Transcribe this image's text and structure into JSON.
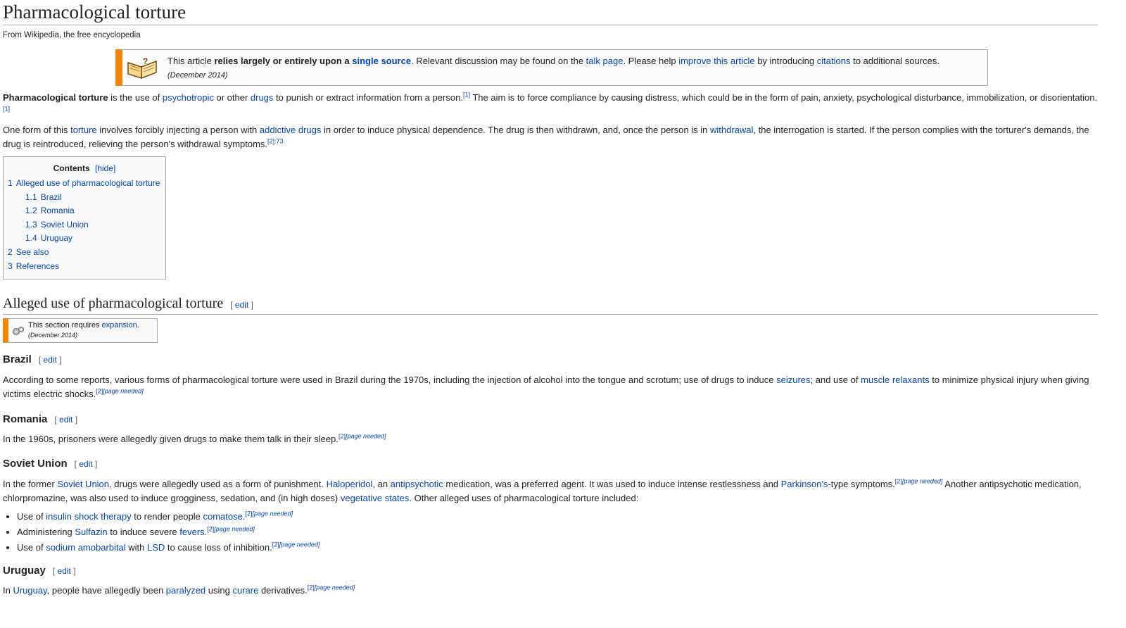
{
  "title": "Pharmacological torture",
  "site_sub": "From Wikipedia, the free encyclopedia",
  "notice": {
    "t1": "This article ",
    "b1": "relies largely or entirely upon a ",
    "l1": "single source",
    "t2": ". Relevant discussion may be found on the ",
    "l2": "talk page",
    "t3": ". Please help ",
    "l3": "improve this article",
    "t4": " by introducing ",
    "l4": "citations",
    "t5": " to additional sources.",
    "date": "(December 2014)",
    "icon": "book-question-icon"
  },
  "intro1": {
    "bold": "Pharmacological torture",
    "t1": " is the use of ",
    "l1": "psychotropic",
    "t2": " or other ",
    "l2": "drugs",
    "t3": " to punish or extract information from a person.",
    "ref1": "[1]",
    "t4": " The aim is to force compliance by causing distress, which could be in the form of pain, anxiety, psychological disturbance, immobilization, or disorientation.",
    "ref2": "[1]"
  },
  "intro2": {
    "t1": "One form of this ",
    "l1": "torture",
    "t2": " involves forcibly injecting a person with ",
    "l2": "addictive drugs",
    "t3": " in order to induce physical dependence. The drug is then withdrawn, and, once the person is in ",
    "l3": "withdrawal",
    "t4": ", the interrogation is started. If the person complies with the torturer's demands, the drug is reintroduced, relieving the person's withdrawal symptoms.",
    "ref": "[2]:73"
  },
  "toc": {
    "title": "Contents",
    "hide": "[hide]",
    "items": [
      {
        "num": "1",
        "label": "Alleged use of pharmacological torture"
      },
      {
        "num": "1.1",
        "label": "Brazil"
      },
      {
        "num": "1.2",
        "label": "Romania"
      },
      {
        "num": "1.3",
        "label": "Soviet Union"
      },
      {
        "num": "1.4",
        "label": "Uruguay"
      },
      {
        "num": "2",
        "label": "See also"
      },
      {
        "num": "3",
        "label": "References"
      }
    ]
  },
  "edit_label": "[ edit ]",
  "edit_open": "[ ",
  "edit_word": "edit",
  "edit_close": " ]",
  "section1": {
    "heading": "Alleged use of pharmacological torture",
    "expansion": {
      "t1": "This section requires ",
      "l1": "expansion",
      "t2": ".",
      "date": "(December 2014)",
      "icon": "gears-icon"
    }
  },
  "brazil": {
    "heading": "Brazil",
    "t1": "According to some reports, various forms of pharmacological torture were used in Brazil during the 1970s, including the injection of alcohol into the tongue and scrotum; use of drugs to induce ",
    "l1": "seizures",
    "t2": "; and use of ",
    "l2": "muscle relaxants",
    "t3": " to minimize physical injury when giving victims electric shocks.",
    "ref": "[2]",
    "pn": "[page needed]"
  },
  "romania": {
    "heading": "Romania",
    "t1": "In the 1960s, prisoners were allegedly given drugs to make them talk in their sleep.",
    "ref": "[2]",
    "pn": "[page needed]"
  },
  "soviet": {
    "heading": "Soviet Union",
    "t1": "In the former ",
    "l1": "Soviet Union",
    "t2": ", drugs were allegedly used as a form of punishment. ",
    "l2": "Haloperidol",
    "t3": ", an ",
    "l3": "antipsychotic",
    "t4": " medication, was a preferred agent. It was used to induce intense restlessness and ",
    "l4": "Parkinson's",
    "t5": "-type symptoms.",
    "ref1": "[2]",
    "pn1": "[page needed]",
    "t6": " Another antipsychotic medication, chlorpromazine, was also used to induce grogginess, sedation, and (in high doses) ",
    "l5": "vegetative states",
    "t7": ". Other alleged uses of pharmacological torture included:",
    "bullets": [
      {
        "t1": "Use of ",
        "l1": "insulin shock therapy",
        "t2": " to render people ",
        "l2": "comatose",
        "t3": ".",
        "ref": "[2]",
        "pn": "[page needed]"
      },
      {
        "t1": "Administering ",
        "l1": "Sulfazin",
        "t2": " to induce severe ",
        "l2": "fevers",
        "t3": ".",
        "ref": "[2]",
        "pn": "[page needed]"
      },
      {
        "t1": "Use of ",
        "l1": "sodium amobarbital",
        "t2": " with ",
        "l2": "LSD",
        "t3": " to cause loss of inhibition.",
        "ref": "[2]",
        "pn": "[page needed]"
      }
    ]
  },
  "uruguay": {
    "heading": "Uruguay",
    "t1": "In ",
    "l1": "Uruguay",
    "t2": ", people have allegedly been ",
    "l2": "paralyzed",
    "t3": " using ",
    "l3": "curare",
    "t4": " derivatives.",
    "ref": "[2]",
    "pn": "[page needed]"
  }
}
